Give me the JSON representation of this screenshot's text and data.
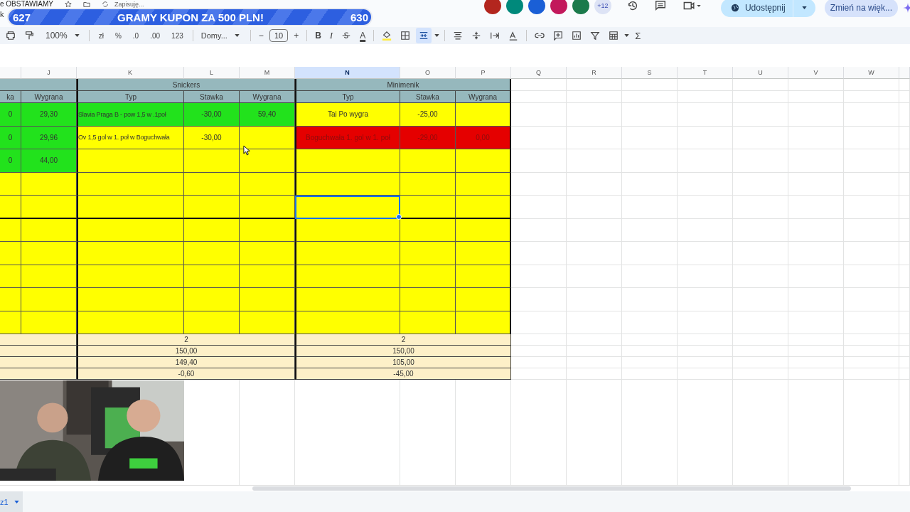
{
  "document": {
    "title": "e OBSTAWIAMY",
    "save_status": "Zapisuję...",
    "menu_fragment": "k"
  },
  "banner": {
    "left_count": "627",
    "text": "GRAMY KUPON ZA 500 PLN!",
    "right_count": "630"
  },
  "header_actions": {
    "extra_users": "+12",
    "share_label": "Udostępnij",
    "upgrade_label": "Zmień na więk..."
  },
  "avatars": [
    {
      "color": "#b3261e"
    },
    {
      "color": "#00897b"
    },
    {
      "color": "#1a5fd6"
    },
    {
      "color": "#c2185b"
    },
    {
      "color": "#1b7a4b"
    }
  ],
  "toolbar": {
    "zoom": "100%",
    "currency": "zł",
    "percent": "%",
    "decrease_decimals": ".0",
    "increase_decimals": ".00",
    "number_format": "123",
    "font": "Domy...",
    "minus": "−",
    "font_size": "10",
    "plus": "+",
    "bold": "B",
    "italic": "I",
    "text_color": "A",
    "sum": "Σ"
  },
  "column_headers": [
    {
      "label": "J",
      "selected": false
    },
    {
      "label": "K",
      "selected": false
    },
    {
      "label": "L",
      "selected": false
    },
    {
      "label": "M",
      "selected": false
    },
    {
      "label": "N",
      "selected": true
    },
    {
      "label": "O",
      "selected": false
    },
    {
      "label": "P",
      "selected": false
    },
    {
      "label": "Q",
      "selected": false
    },
    {
      "label": "R",
      "selected": false
    },
    {
      "label": "S",
      "selected": false
    },
    {
      "label": "T",
      "selected": false
    },
    {
      "label": "U",
      "selected": false
    },
    {
      "label": "V",
      "selected": false
    },
    {
      "label": "W",
      "selected": false
    }
  ],
  "groups": [
    "Snickers",
    "Minimenik"
  ],
  "subheaders": [
    "ka",
    "Wygrana",
    "Typ",
    "Stawka",
    "Wygrana",
    "Typ",
    "Stawka",
    "Wygrana"
  ],
  "rows": [
    {
      "cells": [
        {
          "text": "0",
          "kind": "won",
          "selected": false
        },
        {
          "text": "29,30",
          "kind": "won",
          "selected": false
        },
        {
          "text": "Slavia Praga B - pow 1,5 w .1poł",
          "kind": "won",
          "selected": false
        },
        {
          "text": "-30,00",
          "kind": "won",
          "selected": false
        },
        {
          "text": "59,40",
          "kind": "won",
          "selected": false
        },
        {
          "text": "Tai Po wygra",
          "kind": "pending",
          "selected": false
        },
        {
          "text": "-25,00",
          "kind": "pending",
          "selected": false
        },
        {
          "kind": "pending",
          "selected": false
        }
      ]
    },
    {
      "cells": [
        {
          "text": "0",
          "kind": "won",
          "selected": false
        },
        {
          "text": "29,96",
          "kind": "won",
          "selected": false
        },
        {
          "text": "Ov 1,5 gol w 1. poł w Boguchwała",
          "kind": "pending",
          "selected": false
        },
        {
          "text": "-30,00",
          "kind": "pending",
          "selected": false
        },
        {
          "kind": "pending",
          "selected": false
        },
        {
          "text": "Boguchwała 1. gol w 1. poł",
          "kind": "lost",
          "selected": false
        },
        {
          "text": "-29,00",
          "kind": "lost",
          "selected": false
        },
        {
          "text": "0,00",
          "kind": "lost",
          "selected": false
        }
      ]
    },
    {
      "cells": [
        {
          "text": "0",
          "kind": "won",
          "selected": false
        },
        {
          "text": "44,00",
          "kind": "won",
          "selected": false
        },
        {
          "kind": "pending",
          "selected": false
        },
        {
          "kind": "pending",
          "selected": false
        },
        {
          "kind": "pending",
          "selected": false
        },
        {
          "kind": "pending",
          "selected": false
        },
        {
          "kind": "pending",
          "selected": false
        },
        {
          "kind": "pending",
          "selected": false
        }
      ]
    },
    {
      "cells": [
        {
          "kind": "pending",
          "selected": false
        },
        {
          "kind": "pending",
          "selected": false
        },
        {
          "kind": "pending",
          "selected": false
        },
        {
          "kind": "pending",
          "selected": false
        },
        {
          "kind": "pending",
          "selected": false
        },
        {
          "kind": "pending",
          "selected": false
        },
        {
          "kind": "pending",
          "selected": false
        },
        {
          "kind": "pending",
          "selected": false
        }
      ]
    },
    {
      "cells": [
        {
          "kind": "pending",
          "selected": false
        },
        {
          "kind": "pending",
          "selected": false
        },
        {
          "kind": "pending",
          "selected": false
        },
        {
          "kind": "pending",
          "selected": false
        },
        {
          "kind": "pending",
          "selected": false
        },
        {
          "kind": "pending",
          "selected": true
        },
        {
          "kind": "pending",
          "selected": false
        },
        {
          "kind": "pending",
          "selected": false
        }
      ]
    },
    {
      "cells": [
        {
          "kind": "pending",
          "selected": false
        },
        {
          "kind": "pending",
          "selected": false
        },
        {
          "kind": "pending",
          "selected": false
        },
        {
          "kind": "pending",
          "selected": false
        },
        {
          "kind": "pending",
          "selected": false
        },
        {
          "kind": "pending",
          "selected": false
        },
        {
          "kind": "pending",
          "selected": false
        },
        {
          "kind": "pending",
          "selected": false
        }
      ]
    },
    {
      "cells": [
        {
          "kind": "pending",
          "selected": false
        },
        {
          "kind": "pending",
          "selected": false
        },
        {
          "kind": "pending",
          "selected": false
        },
        {
          "kind": "pending",
          "selected": false
        },
        {
          "kind": "pending",
          "selected": false
        },
        {
          "kind": "pending",
          "selected": false
        },
        {
          "kind": "pending",
          "selected": false
        },
        {
          "kind": "pending",
          "selected": false
        }
      ]
    },
    {
      "cells": [
        {
          "kind": "pending",
          "selected": false
        },
        {
          "kind": "pending",
          "selected": false
        },
        {
          "kind": "pending",
          "selected": false
        },
        {
          "kind": "pending",
          "selected": false
        },
        {
          "kind": "pending",
          "selected": false
        },
        {
          "kind": "pending",
          "selected": false
        },
        {
          "kind": "pending",
          "selected": false
        },
        {
          "kind": "pending",
          "selected": false
        }
      ]
    },
    {
      "cells": [
        {
          "kind": "pending",
          "selected": false
        },
        {
          "kind": "pending",
          "selected": false
        },
        {
          "kind": "pending",
          "selected": false
        },
        {
          "kind": "pending",
          "selected": false
        },
        {
          "kind": "pending",
          "selected": false
        },
        {
          "kind": "pending",
          "selected": false
        },
        {
          "kind": "pending",
          "selected": false
        },
        {
          "kind": "pending",
          "selected": false
        }
      ]
    },
    {
      "cells": [
        {
          "kind": "pending",
          "selected": false
        },
        {
          "kind": "pending",
          "selected": false
        },
        {
          "kind": "pending",
          "selected": false
        },
        {
          "kind": "pending",
          "selected": false
        },
        {
          "kind": "pending",
          "selected": false
        },
        {
          "kind": "pending",
          "selected": false
        },
        {
          "kind": "pending",
          "selected": false
        },
        {
          "kind": "pending",
          "selected": false
        }
      ]
    }
  ],
  "summary": [
    {
      "snickers": "2",
      "minimenik": "2"
    },
    {
      "snickers": "150,00",
      "minimenik": "150,00"
    },
    {
      "snickers": "149,40",
      "minimenik": "105,00"
    },
    {
      "snickers": "-0,60",
      "minimenik": "-45,00"
    }
  ],
  "sheet_tab": {
    "label": "z1"
  }
}
